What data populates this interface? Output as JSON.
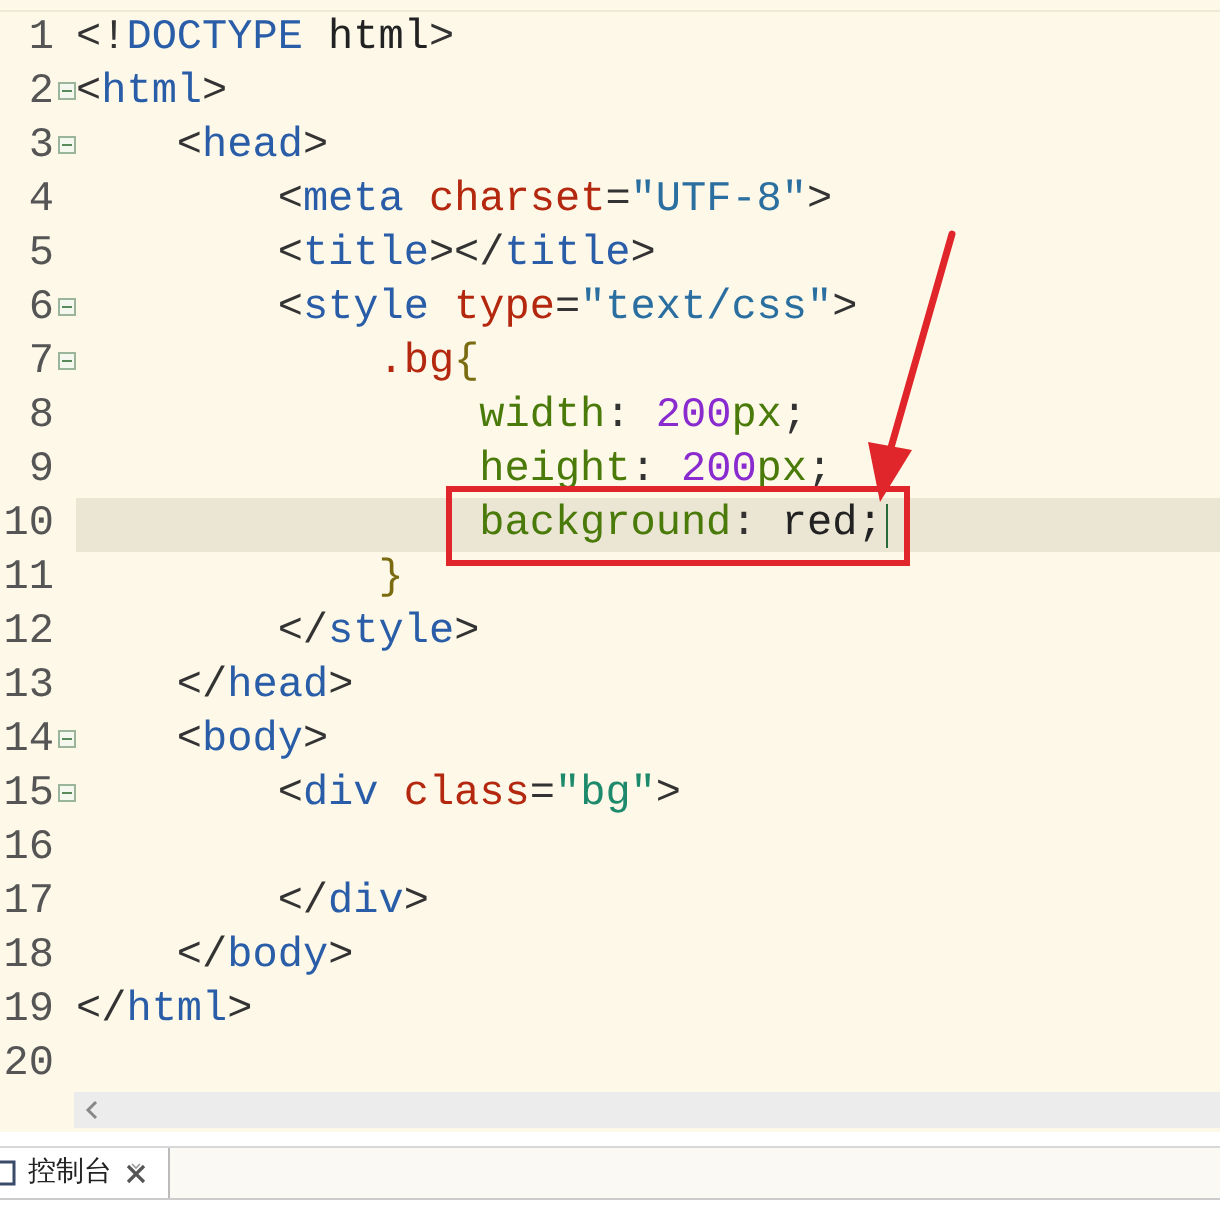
{
  "editor": {
    "lines": [
      {
        "number": "1",
        "fold": false,
        "current": false,
        "boxed": false,
        "tokens": [
          {
            "kind": "punct",
            "text": "<!"
          },
          {
            "kind": "tag",
            "text": "DOCTYPE"
          },
          {
            "kind": "plain",
            "text": " html"
          },
          {
            "kind": "punct",
            "text": ">"
          }
        ]
      },
      {
        "number": "2",
        "fold": true,
        "current": false,
        "boxed": false,
        "tokens": [
          {
            "kind": "punct",
            "text": "<"
          },
          {
            "kind": "tag",
            "text": "html"
          },
          {
            "kind": "punct",
            "text": ">"
          }
        ]
      },
      {
        "number": "3",
        "fold": true,
        "current": false,
        "boxed": false,
        "tokens": [
          {
            "kind": "punct",
            "text": "    <"
          },
          {
            "kind": "tag",
            "text": "head"
          },
          {
            "kind": "punct",
            "text": ">"
          }
        ]
      },
      {
        "number": "4",
        "fold": false,
        "current": false,
        "boxed": false,
        "tokens": [
          {
            "kind": "punct",
            "text": "        <"
          },
          {
            "kind": "tag",
            "text": "meta"
          },
          {
            "kind": "attr",
            "text": " charset"
          },
          {
            "kind": "punct",
            "text": "="
          },
          {
            "kind": "value",
            "text": "\"UTF-8\""
          },
          {
            "kind": "punct",
            "text": ">"
          }
        ]
      },
      {
        "number": "5",
        "fold": false,
        "current": false,
        "boxed": false,
        "tokens": [
          {
            "kind": "punct",
            "text": "        <"
          },
          {
            "kind": "tag",
            "text": "title"
          },
          {
            "kind": "punct",
            "text": "></"
          },
          {
            "kind": "tag",
            "text": "title"
          },
          {
            "kind": "punct",
            "text": ">"
          }
        ]
      },
      {
        "number": "6",
        "fold": true,
        "current": false,
        "boxed": false,
        "tokens": [
          {
            "kind": "punct",
            "text": "        <"
          },
          {
            "kind": "tag",
            "text": "style"
          },
          {
            "kind": "attr",
            "text": " type"
          },
          {
            "kind": "punct",
            "text": "="
          },
          {
            "kind": "value",
            "text": "\"text/css\""
          },
          {
            "kind": "punct",
            "text": ">"
          }
        ]
      },
      {
        "number": "7",
        "fold": true,
        "current": false,
        "boxed": false,
        "tokens": [
          {
            "kind": "selector",
            "text": "            .bg"
          },
          {
            "kind": "brace",
            "text": "{"
          }
        ]
      },
      {
        "number": "8",
        "fold": false,
        "current": false,
        "boxed": false,
        "tokens": [
          {
            "kind": "property",
            "text": "                width"
          },
          {
            "kind": "punct",
            "text": ": "
          },
          {
            "kind": "number",
            "text": "200"
          },
          {
            "kind": "property",
            "text": "px"
          },
          {
            "kind": "punct",
            "text": ";"
          }
        ]
      },
      {
        "number": "9",
        "fold": false,
        "current": false,
        "boxed": false,
        "tokens": [
          {
            "kind": "property",
            "text": "                height"
          },
          {
            "kind": "punct",
            "text": ": "
          },
          {
            "kind": "number",
            "text": "200"
          },
          {
            "kind": "property",
            "text": "px"
          },
          {
            "kind": "punct",
            "text": ";"
          }
        ]
      },
      {
        "number": "10",
        "fold": false,
        "current": true,
        "boxed": true,
        "tokens": [
          {
            "kind": "property",
            "text": "                background"
          },
          {
            "kind": "punct",
            "text": ": "
          },
          {
            "kind": "plain",
            "text": "red;"
          }
        ]
      },
      {
        "number": "11",
        "fold": false,
        "current": false,
        "boxed": false,
        "tokens": [
          {
            "kind": "brace",
            "text": "            }"
          }
        ]
      },
      {
        "number": "12",
        "fold": false,
        "current": false,
        "boxed": false,
        "tokens": [
          {
            "kind": "punct",
            "text": "        </"
          },
          {
            "kind": "tag",
            "text": "style"
          },
          {
            "kind": "punct",
            "text": ">"
          }
        ]
      },
      {
        "number": "13",
        "fold": false,
        "current": false,
        "boxed": false,
        "tokens": [
          {
            "kind": "punct",
            "text": "    </"
          },
          {
            "kind": "tag",
            "text": "head"
          },
          {
            "kind": "punct",
            "text": ">"
          }
        ]
      },
      {
        "number": "14",
        "fold": true,
        "current": false,
        "boxed": false,
        "tokens": [
          {
            "kind": "punct",
            "text": "    <"
          },
          {
            "kind": "tag",
            "text": "body"
          },
          {
            "kind": "punct",
            "text": ">"
          }
        ]
      },
      {
        "number": "15",
        "fold": true,
        "current": false,
        "boxed": false,
        "tokens": [
          {
            "kind": "punct",
            "text": "        <"
          },
          {
            "kind": "tag",
            "text": "div"
          },
          {
            "kind": "attr",
            "text": " class"
          },
          {
            "kind": "punct",
            "text": "="
          },
          {
            "kind": "string",
            "text": "\"bg\""
          },
          {
            "kind": "punct",
            "text": ">"
          }
        ]
      },
      {
        "number": "16",
        "fold": false,
        "current": false,
        "boxed": false
      },
      {
        "number": "17",
        "fold": false,
        "current": false,
        "boxed": false,
        "tokens": [
          {
            "kind": "punct",
            "text": "        </"
          },
          {
            "kind": "tag",
            "text": "div"
          },
          {
            "kind": "punct",
            "text": ">"
          }
        ]
      },
      {
        "number": "18",
        "fold": false,
        "current": false,
        "boxed": false,
        "tokens": [
          {
            "kind": "punct",
            "text": "    </"
          },
          {
            "kind": "tag",
            "text": "body"
          },
          {
            "kind": "punct",
            "text": ">"
          }
        ]
      },
      {
        "number": "19",
        "fold": false,
        "current": false,
        "boxed": false,
        "tokens": [
          {
            "kind": "punct",
            "text": "</"
          },
          {
            "kind": "tag",
            "text": "html"
          },
          {
            "kind": "punct",
            "text": ">"
          }
        ]
      },
      {
        "number": "20",
        "fold": false,
        "current": false,
        "boxed": false
      }
    ]
  },
  "bottom_panel": {
    "tabs": [
      {
        "label": "控制台",
        "selected": true
      }
    ]
  }
}
